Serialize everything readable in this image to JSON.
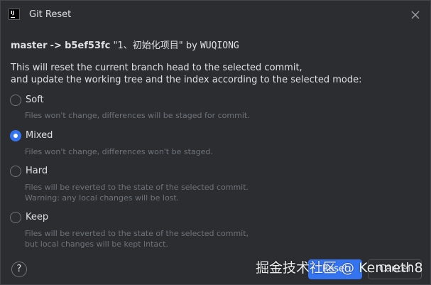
{
  "window": {
    "title": "Git Reset",
    "app_icon": "intellij-idea-icon",
    "close_icon": "close-icon"
  },
  "commit": {
    "branch": "master",
    "arrow": "->",
    "hash": "b5ef53fc",
    "message": "\"1、初始化项目\"",
    "by": "by",
    "author": "WUQIONG"
  },
  "description": {
    "line1": "This will reset the current branch head to the selected commit,",
    "line2": "and update the working tree and the index according to the selected mode:"
  },
  "modes": [
    {
      "label": "Soft",
      "selected": false,
      "hint_lines": [
        "Files won't change, differences will be staged for commit."
      ]
    },
    {
      "label": "Mixed",
      "selected": true,
      "hint_lines": [
        "Files won't change, differences won't be staged."
      ]
    },
    {
      "label": "Hard",
      "selected": false,
      "hint_lines": [
        "Files will be reverted to the state of the selected commit.",
        "Warning: any local changes will be lost."
      ]
    },
    {
      "label": "Keep",
      "selected": false,
      "hint_lines": [
        "Files will be reverted to the state of the selected commit,",
        "but local changes will be kept intact."
      ]
    }
  ],
  "footer": {
    "help_label": "?",
    "reset_label": "Reset",
    "cancel_label": "Cancel"
  },
  "watermark": "掘金技术社区 @ Kenneth8",
  "colors": {
    "background": "#2b2d30",
    "text": "#dfe1e5",
    "hint_text": "#6f737a",
    "accent": "#3574f0"
  }
}
